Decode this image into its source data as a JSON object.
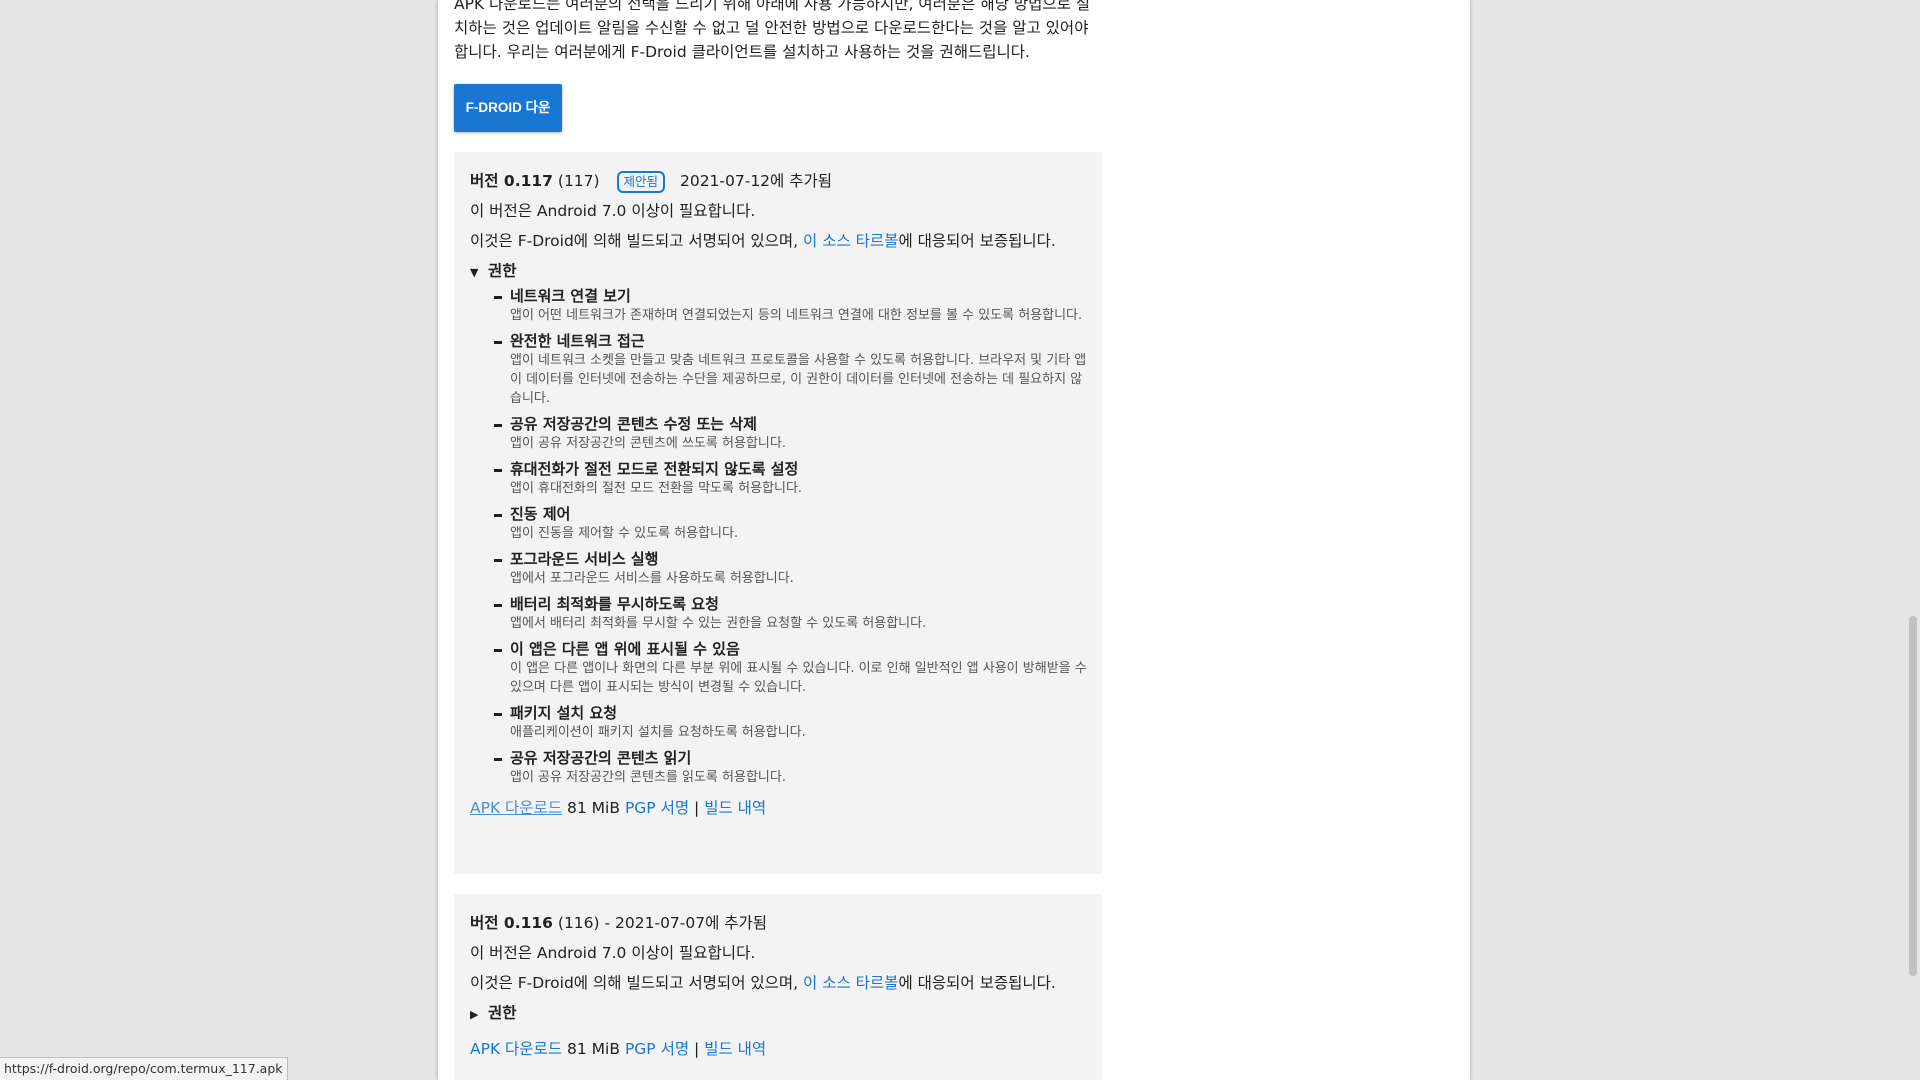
{
  "intro": "APK 다운로드는 여러분의 선택을 드리기 위해 아래에 사용 가능하지만, 여러분은 해당 방법으로 설치하는 것은 업데이트 알림을 수신할 수 없고 덜 안전한 방법으로 다운로드한다는 것을 알고 있어야 합니다. 우리는 여러분에게 F-Droid 클라이언트를 설치하고 사용하는 것을 권해드립니다.",
  "download_button": "F-DROID 다운로드",
  "versions": [
    {
      "version_label": "버전 0.117",
      "code": "(117)",
      "badge": "제안됨",
      "added": "2021-07-12에 추가됨",
      "requires": "이 버전은 Android 7.0 이상이 필요합니다.",
      "built_prefix": "이것은 F-Droid에 의해 빌드되고 서명되어 있으며, ",
      "tarball_link": "이 소스 타르볼",
      "built_suffix": "에 대응되어 보증됩니다.",
      "permissions_label": "권한",
      "permissions": [
        {
          "title": "네트워크 연결 보기",
          "desc": "앱이 어떤 네트워크가 존재하며 연결되었는지 등의 네트워크 연결에 대한 정보를 볼 수 있도록 허용합니다."
        },
        {
          "title": "완전한 네트워크 접근",
          "desc": "앱이 네트워크 소켓을 만들고 맞춤 네트워크 프로토콜을 사용할 수 있도록 허용합니다. 브라우저 및 기타 앱이 데이터를 인터넷에 전송하는 수단을 제공하므로, 이 권한이 데이터를 인터넷에 전송하는 데 필요하지 않습니다."
        },
        {
          "title": "공유 저장공간의 콘텐츠 수정 또는 삭제",
          "desc": "앱이 공유 저장공간의 콘텐츠에 쓰도록 허용합니다."
        },
        {
          "title": "휴대전화가 절전 모드로 전환되지 않도록 설정",
          "desc": "앱이 휴대전화의 절전 모드 전환을 막도록 허용합니다."
        },
        {
          "title": "진동 제어",
          "desc": "앱이 진동을 제어할 수 있도록 허용합니다."
        },
        {
          "title": "포그라운드 서비스 실행",
          "desc": "앱에서 포그라운드 서비스를 사용하도록 허용합니다."
        },
        {
          "title": "배터리 최적화를 무시하도록 요청",
          "desc": "앱에서 배터리 최적화를 무시할 수 있는 권한을 요청할 수 있도록 허용합니다."
        },
        {
          "title": "이 앱은 다른 앱 위에 표시될 수 있음",
          "desc": "이 앱은 다른 앱이나 화면의 다른 부분 위에 표시될 수 있습니다. 이로 인해 일반적인 앱 사용이 방해받을 수 있으며 다른 앱이 표시되는 방식이 변경될 수 있습니다."
        },
        {
          "title": "패키지 설치 요청",
          "desc": "애플리케이션이 패키지 설치를 요청하도록 허용합니다."
        },
        {
          "title": "공유 저장공간의 콘텐츠 읽기",
          "desc": "앱이 공유 저장공간의 콘텐츠를 읽도록 허용합니다."
        }
      ],
      "apk_link": "APK 다운로드",
      "size": "81 MiB",
      "pgp_link": "PGP 서명",
      "separator": "|",
      "build_link": "빌드 내역"
    },
    {
      "version_label": "버전 0.116",
      "code": "(116)",
      "added": " - 2021-07-07에 추가됨",
      "requires": "이 버전은 Android 7.0 이상이 필요합니다.",
      "built_prefix": "이것은 F-Droid에 의해 빌드되고 서명되어 있으며, ",
      "tarball_link": "이 소스 타르볼",
      "built_suffix": "에 대응되어 보증됩니다.",
      "permissions_label": "권한",
      "apk_link": "APK 다운로드",
      "size": "81 MiB",
      "pgp_link": "PGP 서명",
      "separator": "|",
      "build_link": "빌드 내역"
    }
  ],
  "status_url": "https://f-droid.org/repo/com.termux_117.apk",
  "colors": {
    "accent": "#1976d2",
    "panel": "#f3f3f3",
    "background": "#e6e6e6"
  }
}
